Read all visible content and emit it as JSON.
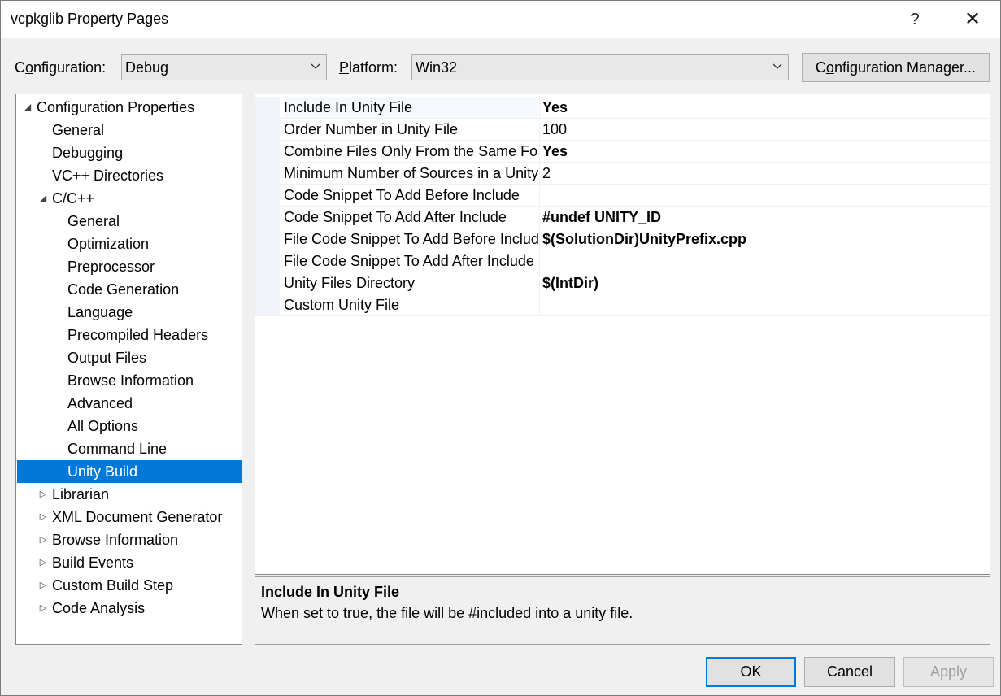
{
  "window": {
    "title": "vcpkglib Property Pages",
    "help": "?",
    "close": "✕"
  },
  "config": {
    "label_pre": "C",
    "label_u": "o",
    "label_post": "nfiguration:",
    "value": "Debug"
  },
  "platform": {
    "label_u": "P",
    "label_post": "latform:",
    "value": "Win32"
  },
  "config_manager": {
    "pre": "C",
    "u": "o",
    "post": "nfiguration Manager..."
  },
  "tree": [
    {
      "label": "Configuration Properties",
      "toggle": "◢"
    },
    {
      "label": "General"
    },
    {
      "label": "Debugging"
    },
    {
      "label": "VC++ Directories"
    },
    {
      "label": "C/C++",
      "toggle": "◢"
    },
    {
      "label": "General"
    },
    {
      "label": "Optimization"
    },
    {
      "label": "Preprocessor"
    },
    {
      "label": "Code Generation"
    },
    {
      "label": "Language"
    },
    {
      "label": "Precompiled Headers"
    },
    {
      "label": "Output Files"
    },
    {
      "label": "Browse Information"
    },
    {
      "label": "Advanced"
    },
    {
      "label": "All Options"
    },
    {
      "label": "Command Line"
    },
    {
      "label": "Unity Build"
    },
    {
      "label": "Librarian",
      "toggle": "▷"
    },
    {
      "label": "XML Document Generator",
      "toggle": "▷"
    },
    {
      "label": "Browse Information",
      "toggle": "▷"
    },
    {
      "label": "Build Events",
      "toggle": "▷"
    },
    {
      "label": "Custom Build Step",
      "toggle": "▷"
    },
    {
      "label": "Code Analysis",
      "toggle": "▷"
    }
  ],
  "properties": [
    {
      "name": "Include In Unity File",
      "value": "Yes"
    },
    {
      "name": "Order Number in Unity File",
      "value": "100"
    },
    {
      "name": "Combine Files Only From the Same Folc",
      "value": "Yes"
    },
    {
      "name": "Minimum Number of Sources in a Unity",
      "value": "2"
    },
    {
      "name": "Code Snippet To Add Before Include",
      "value": ""
    },
    {
      "name": "Code Snippet To Add After Include",
      "value": "#undef UNITY_ID"
    },
    {
      "name": "File Code Snippet To Add Before Include",
      "value": "$(SolutionDir)UnityPrefix.cpp"
    },
    {
      "name": "File Code Snippet To Add After Include",
      "value": ""
    },
    {
      "name": "Unity Files Directory",
      "value": "$(IntDir)"
    },
    {
      "name": "Custom Unity File",
      "value": ""
    }
  ],
  "description": {
    "title": "Include In Unity File",
    "text": "When set to true, the file will be #included into a unity file."
  },
  "buttons": {
    "ok": "OK",
    "cancel": "Cancel",
    "apply": "Apply"
  },
  "colors": {
    "selection": "#0078d7",
    "disabled_text": "#a0a0a0"
  }
}
